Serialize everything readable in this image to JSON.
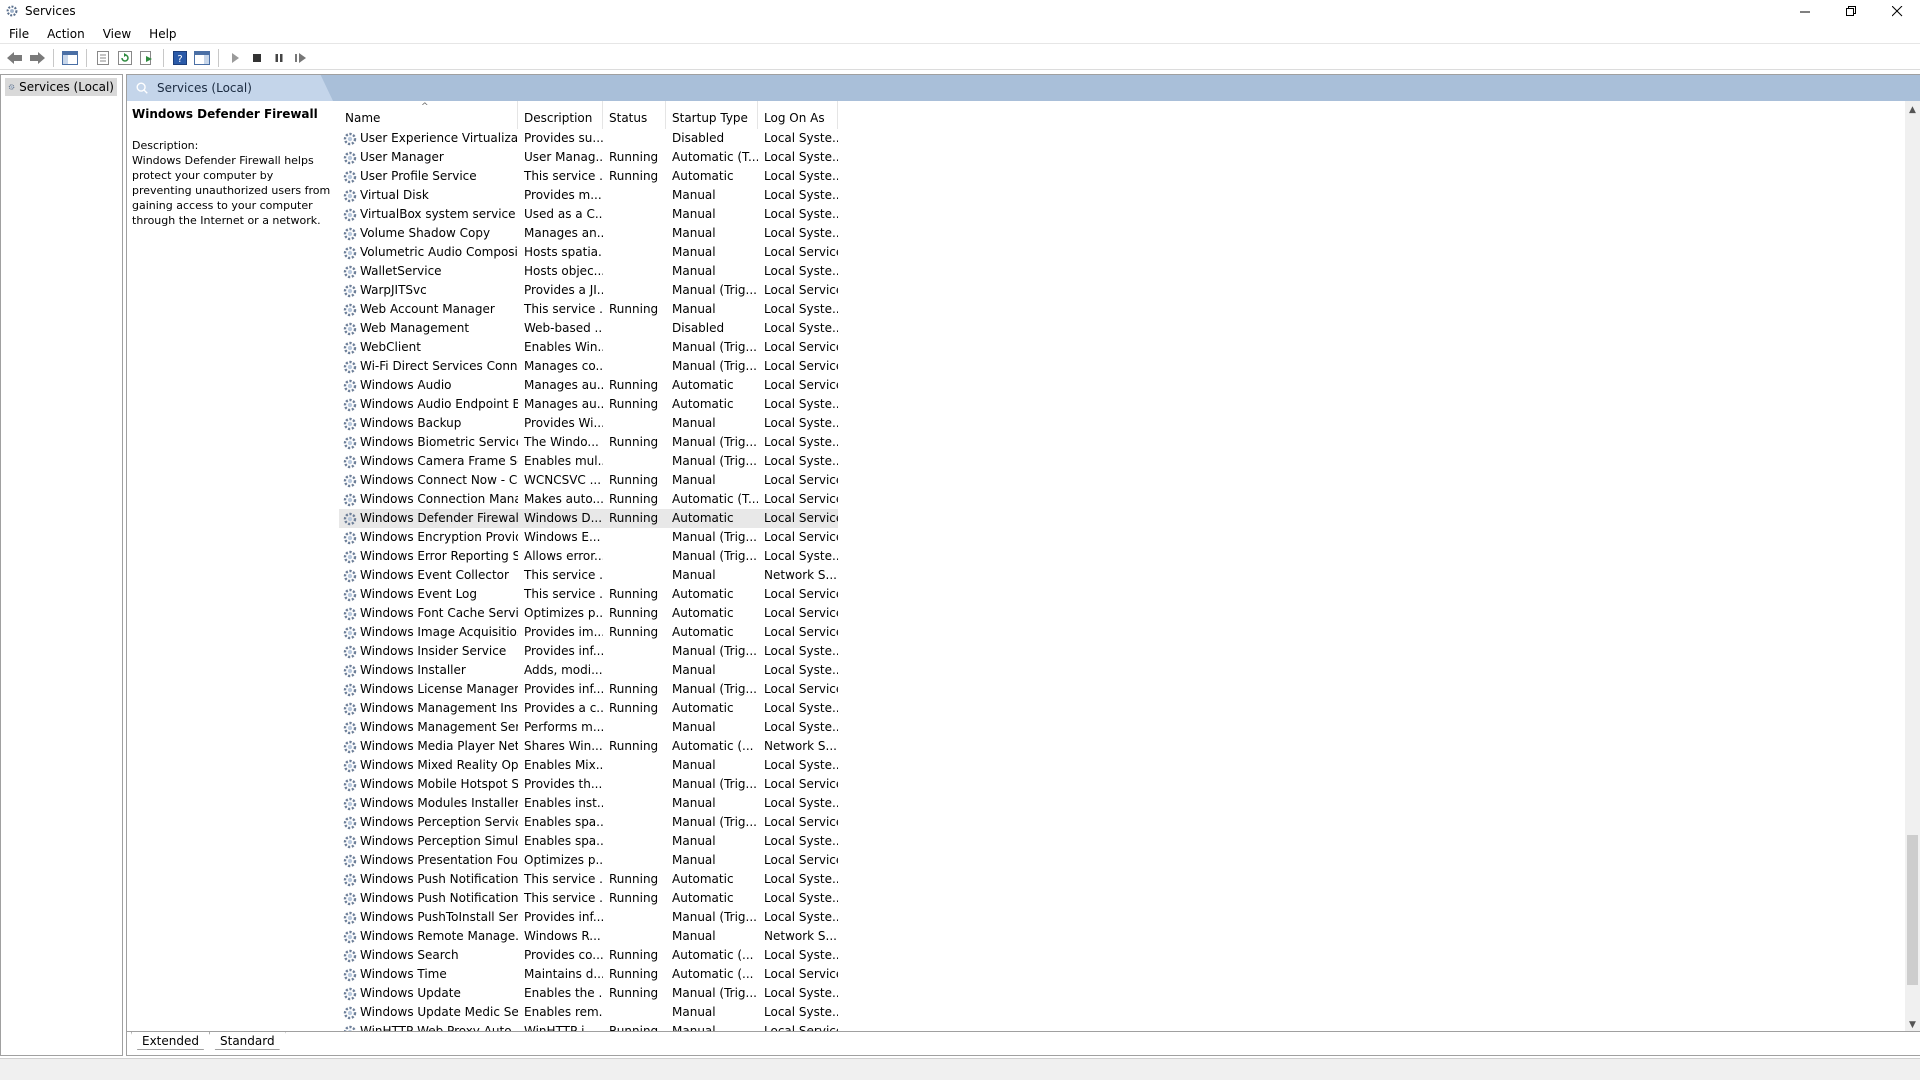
{
  "window": {
    "title": "Services"
  },
  "menu": [
    "File",
    "Action",
    "View",
    "Help"
  ],
  "tree": {
    "root_label": "Services (Local)"
  },
  "panel": {
    "header": "Services (Local)",
    "selected_name": "Windows Defender Firewall",
    "description_label": "Description:",
    "description_text": "Windows Defender Firewall helps protect your computer by preventing unauthorized users from gaining access to your computer through the Internet or a network."
  },
  "columns": [
    "Name",
    "Description",
    "Status",
    "Startup Type",
    "Log On As"
  ],
  "rows": [
    {
      "name": "User Experience Virtualizati...",
      "desc": "Provides su...",
      "status": "",
      "startup": "Disabled",
      "logon": "Local Syste..."
    },
    {
      "name": "User Manager",
      "desc": "User Manag...",
      "status": "Running",
      "startup": "Automatic (T...",
      "logon": "Local Syste..."
    },
    {
      "name": "User Profile Service",
      "desc": "This service ...",
      "status": "Running",
      "startup": "Automatic",
      "logon": "Local Syste..."
    },
    {
      "name": "Virtual Disk",
      "desc": "Provides m...",
      "status": "",
      "startup": "Manual",
      "logon": "Local Syste..."
    },
    {
      "name": "VirtualBox system service",
      "desc": "Used as a C...",
      "status": "",
      "startup": "Manual",
      "logon": "Local Syste..."
    },
    {
      "name": "Volume Shadow Copy",
      "desc": "Manages an...",
      "status": "",
      "startup": "Manual",
      "logon": "Local Syste..."
    },
    {
      "name": "Volumetric Audio Composit...",
      "desc": "Hosts spatia...",
      "status": "",
      "startup": "Manual",
      "logon": "Local Service"
    },
    {
      "name": "WalletService",
      "desc": "Hosts objec...",
      "status": "",
      "startup": "Manual",
      "logon": "Local Syste..."
    },
    {
      "name": "WarpJITSvc",
      "desc": "Provides a JI...",
      "status": "",
      "startup": "Manual (Trig...",
      "logon": "Local Service"
    },
    {
      "name": "Web Account Manager",
      "desc": "This service ...",
      "status": "Running",
      "startup": "Manual",
      "logon": "Local Syste..."
    },
    {
      "name": "Web Management",
      "desc": "Web-based ...",
      "status": "",
      "startup": "Disabled",
      "logon": "Local Syste..."
    },
    {
      "name": "WebClient",
      "desc": "Enables Win...",
      "status": "",
      "startup": "Manual (Trig...",
      "logon": "Local Service"
    },
    {
      "name": "Wi-Fi Direct Services Conne...",
      "desc": "Manages co...",
      "status": "",
      "startup": "Manual (Trig...",
      "logon": "Local Service"
    },
    {
      "name": "Windows Audio",
      "desc": "Manages au...",
      "status": "Running",
      "startup": "Automatic",
      "logon": "Local Service"
    },
    {
      "name": "Windows Audio Endpoint B...",
      "desc": "Manages au...",
      "status": "Running",
      "startup": "Automatic",
      "logon": "Local Syste..."
    },
    {
      "name": "Windows Backup",
      "desc": "Provides Wi...",
      "status": "",
      "startup": "Manual",
      "logon": "Local Syste..."
    },
    {
      "name": "Windows Biometric Service",
      "desc": "The Windo...",
      "status": "Running",
      "startup": "Manual (Trig...",
      "logon": "Local Syste..."
    },
    {
      "name": "Windows Camera Frame Se...",
      "desc": "Enables mul...",
      "status": "",
      "startup": "Manual (Trig...",
      "logon": "Local Syste..."
    },
    {
      "name": "Windows Connect Now - C...",
      "desc": "WCNCSVC ...",
      "status": "Running",
      "startup": "Manual",
      "logon": "Local Service"
    },
    {
      "name": "Windows Connection Mana...",
      "desc": "Makes auto...",
      "status": "Running",
      "startup": "Automatic (T...",
      "logon": "Local Service"
    },
    {
      "name": "Windows Defender Firewall",
      "desc": "Windows D...",
      "status": "Running",
      "startup": "Automatic",
      "logon": "Local Service",
      "selected": true
    },
    {
      "name": "Windows Encryption Provid...",
      "desc": "Windows E...",
      "status": "",
      "startup": "Manual (Trig...",
      "logon": "Local Service"
    },
    {
      "name": "Windows Error Reporting Se...",
      "desc": "Allows error...",
      "status": "",
      "startup": "Manual (Trig...",
      "logon": "Local Syste..."
    },
    {
      "name": "Windows Event Collector",
      "desc": "This service ...",
      "status": "",
      "startup": "Manual",
      "logon": "Network S..."
    },
    {
      "name": "Windows Event Log",
      "desc": "This service ...",
      "status": "Running",
      "startup": "Automatic",
      "logon": "Local Service"
    },
    {
      "name": "Windows Font Cache Service",
      "desc": "Optimizes p...",
      "status": "Running",
      "startup": "Automatic",
      "logon": "Local Service"
    },
    {
      "name": "Windows Image Acquisitio...",
      "desc": "Provides im...",
      "status": "Running",
      "startup": "Automatic",
      "logon": "Local Service"
    },
    {
      "name": "Windows Insider Service",
      "desc": "Provides inf...",
      "status": "",
      "startup": "Manual (Trig...",
      "logon": "Local Syste..."
    },
    {
      "name": "Windows Installer",
      "desc": "Adds, modi...",
      "status": "",
      "startup": "Manual",
      "logon": "Local Syste..."
    },
    {
      "name": "Windows License Manager ...",
      "desc": "Provides inf...",
      "status": "Running",
      "startup": "Manual (Trig...",
      "logon": "Local Service"
    },
    {
      "name": "Windows Management Inst...",
      "desc": "Provides a c...",
      "status": "Running",
      "startup": "Automatic",
      "logon": "Local Syste..."
    },
    {
      "name": "Windows Management Ser...",
      "desc": "Performs m...",
      "status": "",
      "startup": "Manual",
      "logon": "Local Syste..."
    },
    {
      "name": "Windows Media Player Net...",
      "desc": "Shares Win...",
      "status": "Running",
      "startup": "Automatic (...",
      "logon": "Network S..."
    },
    {
      "name": "Windows Mixed Reality Op...",
      "desc": "Enables Mix...",
      "status": "",
      "startup": "Manual",
      "logon": "Local Syste..."
    },
    {
      "name": "Windows Mobile Hotspot S...",
      "desc": "Provides th...",
      "status": "",
      "startup": "Manual (Trig...",
      "logon": "Local Service"
    },
    {
      "name": "Windows Modules Installer",
      "desc": "Enables inst...",
      "status": "",
      "startup": "Manual",
      "logon": "Local Syste..."
    },
    {
      "name": "Windows Perception Service",
      "desc": "Enables spa...",
      "status": "",
      "startup": "Manual (Trig...",
      "logon": "Local Service"
    },
    {
      "name": "Windows Perception Simul...",
      "desc": "Enables spa...",
      "status": "",
      "startup": "Manual",
      "logon": "Local Syste..."
    },
    {
      "name": "Windows Presentation Fou...",
      "desc": "Optimizes p...",
      "status": "",
      "startup": "Manual",
      "logon": "Local Service"
    },
    {
      "name": "Windows Push Notification...",
      "desc": "This service ...",
      "status": "Running",
      "startup": "Automatic",
      "logon": "Local Syste..."
    },
    {
      "name": "Windows Push Notification...",
      "desc": "This service ...",
      "status": "Running",
      "startup": "Automatic",
      "logon": "Local Syste..."
    },
    {
      "name": "Windows PushToInstall Serv...",
      "desc": "Provides inf...",
      "status": "",
      "startup": "Manual (Trig...",
      "logon": "Local Syste..."
    },
    {
      "name": "Windows Remote Manage...",
      "desc": "Windows R...",
      "status": "",
      "startup": "Manual",
      "logon": "Network S..."
    },
    {
      "name": "Windows Search",
      "desc": "Provides co...",
      "status": "Running",
      "startup": "Automatic (...",
      "logon": "Local Syste..."
    },
    {
      "name": "Windows Time",
      "desc": "Maintains d...",
      "status": "Running",
      "startup": "Automatic (...",
      "logon": "Local Service"
    },
    {
      "name": "Windows Update",
      "desc": "Enables the ...",
      "status": "Running",
      "startup": "Manual (Trig...",
      "logon": "Local Syste..."
    },
    {
      "name": "Windows Update Medic Ser...",
      "desc": "Enables rem...",
      "status": "",
      "startup": "Manual",
      "logon": "Local Syste..."
    },
    {
      "name": "WinHTTP Web Proxy Auto-...",
      "desc": "WinHTTP i...",
      "status": "Running",
      "startup": "Manual",
      "logon": "Local Service"
    }
  ],
  "tabs": [
    "Extended",
    "Standard"
  ],
  "colors": {
    "header_bar": "#a9bfd9",
    "header_tab": "#c4d5ea",
    "selected_row": "#e8e8e8"
  },
  "icons": [
    "services-gear-icon",
    "back-arrow-icon",
    "forward-arrow-icon",
    "start-icon",
    "stop-icon",
    "pause-icon",
    "resume-icon"
  ]
}
